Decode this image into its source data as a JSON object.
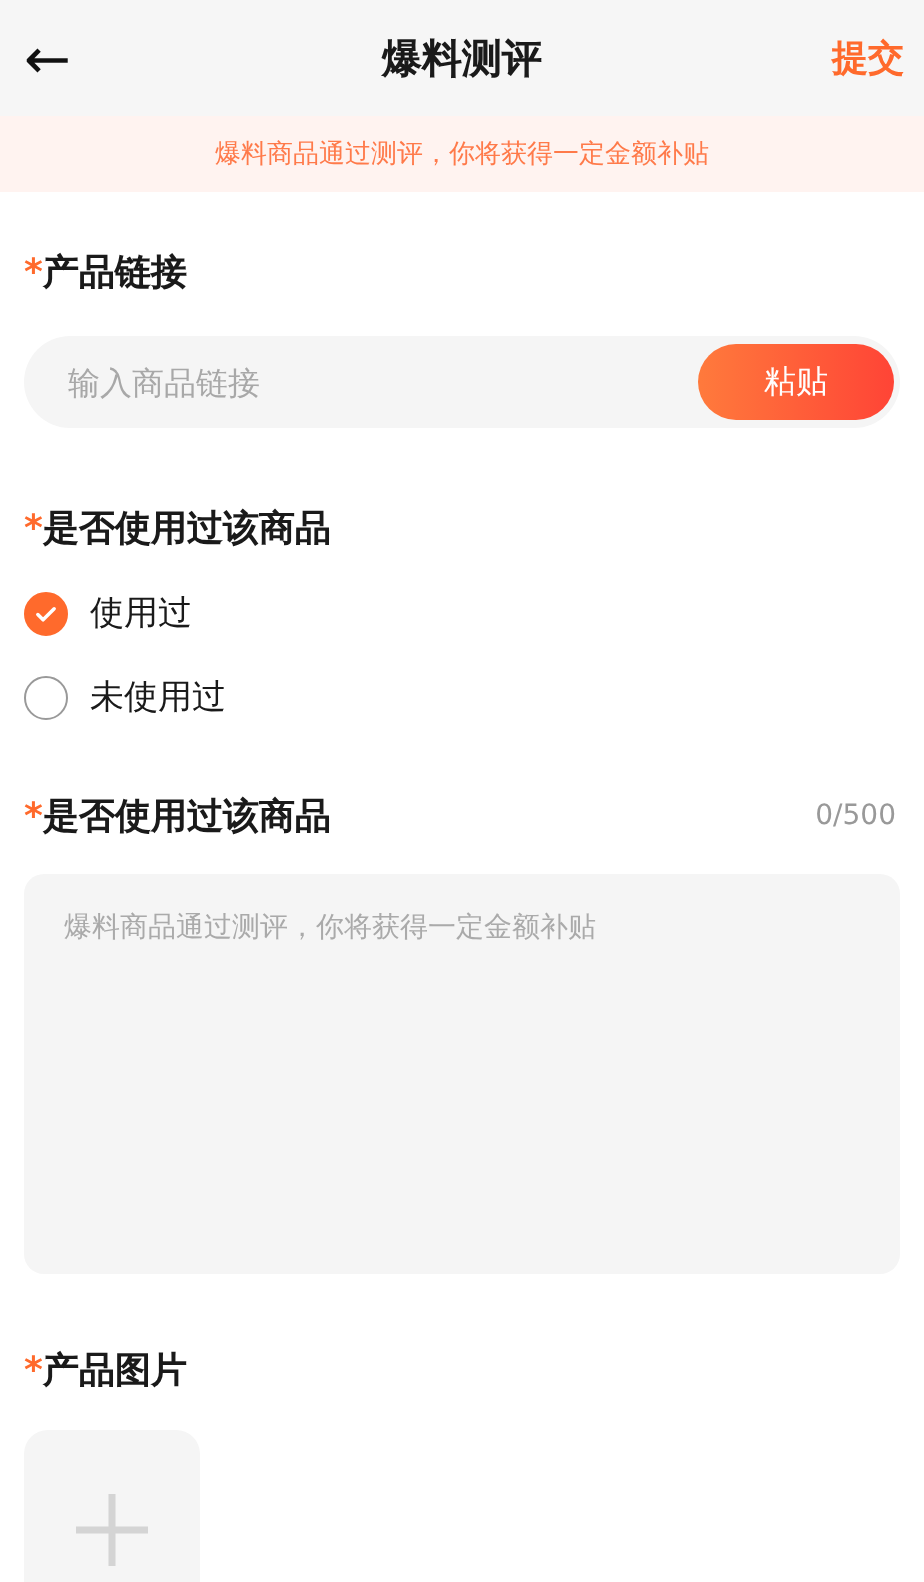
{
  "header": {
    "back": "←",
    "title": "爆料测评",
    "action": "提交"
  },
  "banner": "爆料商品通过测评，你将获得一定金额补贴",
  "link_section": {
    "mark": "*",
    "label": "产品链接",
    "placeholder": "输入商品链接",
    "button": "粘贴"
  },
  "usage_section": {
    "mark": "*",
    "label": "是否使用过该商品",
    "options": [
      {
        "label": "使用过",
        "selected": true
      },
      {
        "label": "未使用过",
        "selected": false
      }
    ]
  },
  "review_section": {
    "mark": "*",
    "label": "是否使用过该商品",
    "counter": "0/500",
    "placeholder": "爆料商品通过测评，你将获得一定金额补贴"
  },
  "image_section": {
    "mark": "*",
    "label": "产品图片"
  }
}
